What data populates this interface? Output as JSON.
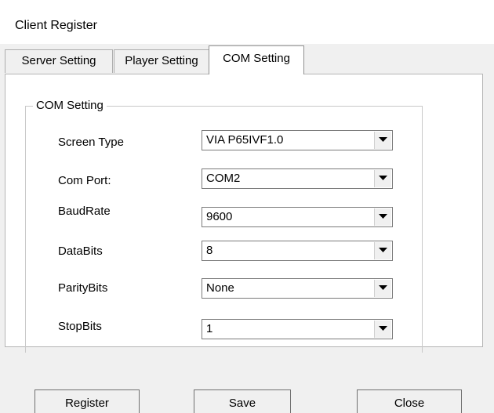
{
  "window": {
    "title": "Client Register"
  },
  "tabs": [
    {
      "label": "Server Setting"
    },
    {
      "label": "Player Setting"
    },
    {
      "label": "COM Setting"
    }
  ],
  "group": {
    "label": "COM Setting"
  },
  "fields": [
    {
      "label": "Screen Type",
      "value": "VIA P65IVF1.0"
    },
    {
      "label": "Com Port:",
      "value": "COM2"
    },
    {
      "label": "BaudRate",
      "value": "9600"
    },
    {
      "label": "DataBits",
      "value": "8"
    },
    {
      "label": "ParityBits",
      "value": "None"
    },
    {
      "label": "StopBits",
      "value": "1"
    }
  ],
  "buttons": {
    "register": "Register",
    "save": "Save",
    "close": "Close"
  }
}
